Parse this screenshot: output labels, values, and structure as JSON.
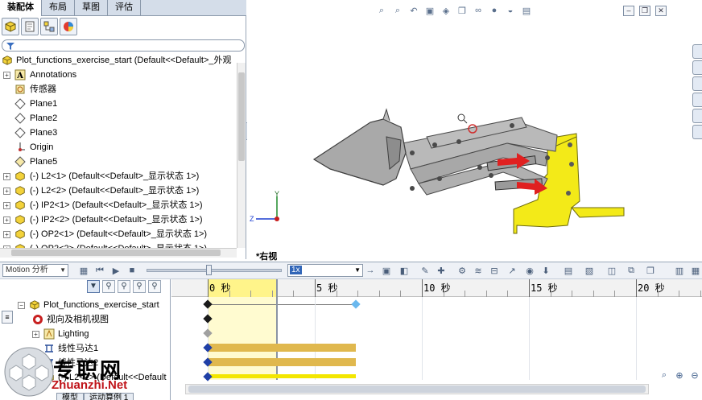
{
  "config_tabs": [
    "装配体",
    "布局",
    "草图",
    "评估"
  ],
  "tree": {
    "root": "Plot_functions_exercise_start  (Default<<Default>_外观",
    "items": [
      {
        "label": "Annotations",
        "icon": "annotations-icon"
      },
      {
        "label": "传感器",
        "icon": "sensor-icon"
      },
      {
        "label": "Plane1",
        "icon": "plane-icon"
      },
      {
        "label": "Plane2",
        "icon": "plane-icon"
      },
      {
        "label": "Plane3",
        "icon": "plane-icon"
      },
      {
        "label": "Origin",
        "icon": "origin-icon"
      },
      {
        "label": "Plane5",
        "icon": "plane-icon"
      },
      {
        "label": "(-) L2<1> (Default<<Default>_显示状态 1>)",
        "icon": "part-icon"
      },
      {
        "label": "(-) L2<2> (Default<<Default>_显示状态 1>)",
        "icon": "part-icon"
      },
      {
        "label": "(-) IP2<1> (Default<<Default>_显示状态 1>)",
        "icon": "part-icon"
      },
      {
        "label": "(-) IP2<2> (Default<<Default>_显示状态 1>)",
        "icon": "part-icon"
      },
      {
        "label": "(-) OP2<1> (Default<<Default>_显示状态 1>)",
        "icon": "part-icon"
      },
      {
        "label": "(-) OP2<2> (Default<<Default>_显示状态 1>)",
        "icon": "part-icon"
      }
    ]
  },
  "viewport": {
    "view_label": "*右视",
    "triad": {
      "y": "Y",
      "z": "Z"
    }
  },
  "motion": {
    "study_type": "Motion 分析",
    "speed": "1x",
    "tree_root": "Plot_functions_exercise_start",
    "tree_items": [
      {
        "label": "视向及相机视图",
        "icon": "camera-view-icon"
      },
      {
        "label": "Lighting",
        "icon": "lighting-icon"
      },
      {
        "label": "线性马达1",
        "icon": "linear-motor-icon"
      },
      {
        "label": "线性马达2",
        "icon": "linear-motor-icon"
      },
      {
        "label": "(-) L2<1> (Default<<Default",
        "icon": "part-icon"
      }
    ],
    "time_ticks": [
      "0 秒",
      "5 秒",
      "10 秒",
      "15 秒",
      "20 秒"
    ],
    "current_time_sec": 3.2,
    "end_time_sec": 6.9,
    "bottom_tabs": [
      "模型",
      "运动算例 1"
    ]
  },
  "watermark": {
    "text": "专职网",
    "url": "Zhuanzhi.Net"
  },
  "colors": {
    "accent_yellow": "#f3e600",
    "bar_gold": "#e0b84e",
    "arrow_red": "#e02020",
    "panel_blue": "#d4dde9"
  }
}
